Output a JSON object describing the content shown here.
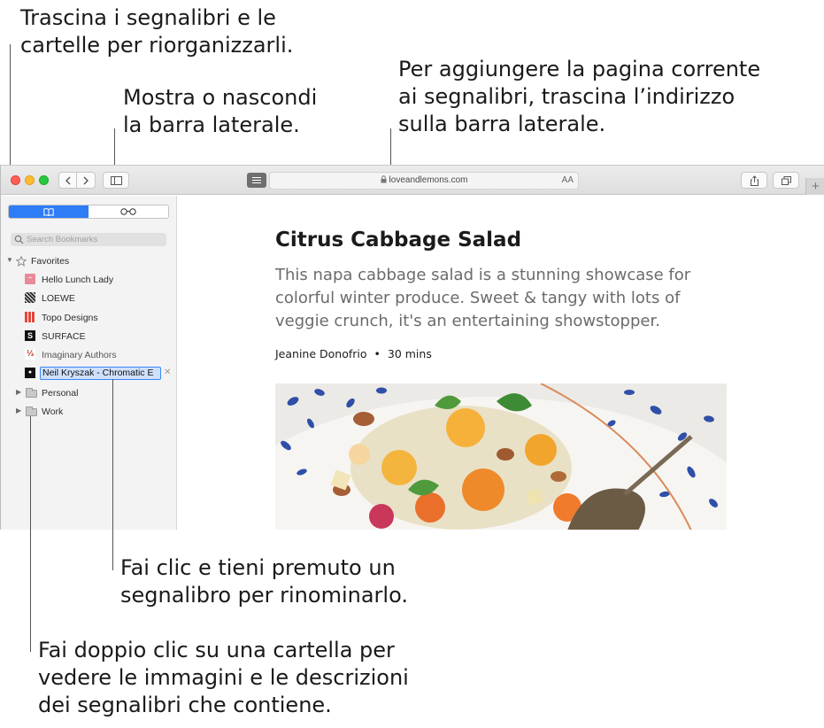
{
  "callouts": {
    "drag": "Trascina i segnalibri e le\ncartelle per riorganizzarli.",
    "sidebar_toggle": "Mostra o nascondi\nla barra laterale.",
    "add_page": "Per aggiungere la pagina corrente\nai segnalibri, trascina l’indirizzo\nsulla barra laterale.",
    "rename": "Fai clic e tieni premuto un\nsegnalibro per rinominarlo.",
    "folder": "Fai doppio clic su una cartella per\nvedere le immagini e le descrizioni\ndei segnalibri che contiene."
  },
  "toolbar": {
    "url": "loveandlemons.com",
    "text_size_label": "AA",
    "new_tab_label": "+"
  },
  "sidebar": {
    "search_placeholder": "Search Bookmarks",
    "favorites_label": "Favorites",
    "bookmarks": [
      {
        "label": "Hello Lunch Lady",
        "icon": "hello-lunch-lady-favicon",
        "color": "#e88a99"
      },
      {
        "label": "LOEWE",
        "icon": "loewe-favicon",
        "color": "#333333"
      },
      {
        "label": "Topo Designs",
        "icon": "topo-designs-favicon",
        "color": "#e2463b"
      },
      {
        "label": "SURFACE",
        "icon": "surface-favicon",
        "color": "#111111"
      },
      {
        "label": "Imaginary Authors",
        "icon": "imaginary-authors-favicon",
        "color": "#c4342b"
      }
    ],
    "editing_bookmark": "Neil Kryszak - Chromatic E",
    "folders": [
      "Personal",
      "Work"
    ]
  },
  "article": {
    "title": "Citrus Cabbage Salad",
    "subtitle": "This napa cabbage salad is a stunning showcase for\ncolorful winter produce. Sweet & tangy with lots of\nveggie crunch, it's an entertaining showstopper.",
    "author": "Jeanine Donofrio",
    "separator": "•",
    "time": "30 mins"
  },
  "colors": {
    "accent": "#2e7cf6",
    "close": "#fc5f57",
    "minimize": "#fdbc2e",
    "zoom": "#28c840"
  }
}
